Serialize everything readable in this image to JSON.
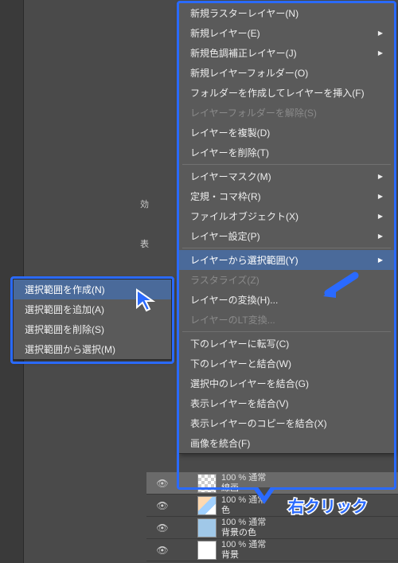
{
  "palette_labels": {
    "effect": "効",
    "display": "表"
  },
  "main_menu": {
    "items": [
      {
        "label": "新規ラスターレイヤー(N)",
        "enabled": true,
        "sub": false
      },
      {
        "label": "新規レイヤー(E)",
        "enabled": true,
        "sub": true
      },
      {
        "label": "新規色調補正レイヤー(J)",
        "enabled": true,
        "sub": true
      },
      {
        "label": "新規レイヤーフォルダー(O)",
        "enabled": true,
        "sub": false
      },
      {
        "label": "フォルダーを作成してレイヤーを挿入(F)",
        "enabled": true,
        "sub": false
      },
      {
        "label": "レイヤーフォルダーを解除(S)",
        "enabled": false,
        "sub": false
      },
      {
        "label": "レイヤーを複製(D)",
        "enabled": true,
        "sub": false
      },
      {
        "label": "レイヤーを削除(T)",
        "enabled": true,
        "sub": false
      },
      {
        "sep": true
      },
      {
        "label": "レイヤーマスク(M)",
        "enabled": true,
        "sub": true
      },
      {
        "label": "定規・コマ枠(R)",
        "enabled": true,
        "sub": true
      },
      {
        "label": "ファイルオブジェクト(X)",
        "enabled": true,
        "sub": true
      },
      {
        "label": "レイヤー設定(P)",
        "enabled": true,
        "sub": true
      },
      {
        "sep": true
      },
      {
        "label": "レイヤーから選択範囲(Y)",
        "enabled": true,
        "sub": true,
        "highlight": true
      },
      {
        "label": "ラスタライズ(Z)",
        "enabled": false,
        "sub": false
      },
      {
        "label": "レイヤーの変換(H)...",
        "enabled": true,
        "sub": false
      },
      {
        "label": "レイヤーのLT変換...",
        "enabled": false,
        "sub": false
      },
      {
        "sep": true
      },
      {
        "label": "下のレイヤーに転写(C)",
        "enabled": true,
        "sub": false
      },
      {
        "label": "下のレイヤーと結合(W)",
        "enabled": true,
        "sub": false
      },
      {
        "label": "選択中のレイヤーを結合(G)",
        "enabled": true,
        "sub": false
      },
      {
        "label": "表示レイヤーを結合(V)",
        "enabled": true,
        "sub": false
      },
      {
        "label": "表示レイヤーのコピーを結合(X)",
        "enabled": true,
        "sub": false
      },
      {
        "label": "画像を統合(F)",
        "enabled": true,
        "sub": false
      }
    ]
  },
  "sub_menu": {
    "items": [
      {
        "label": "選択範囲を作成(N)",
        "highlight": true
      },
      {
        "label": "選択範囲を追加(A)"
      },
      {
        "label": "選択範囲を削除(S)"
      },
      {
        "label": "選択範囲から選択(M)"
      }
    ]
  },
  "callout_text": "右クリック",
  "layers": [
    {
      "opacity": "100 % 通常",
      "name": "線画",
      "thumb": "checker",
      "selected": true
    },
    {
      "opacity": "100 % 通常",
      "name": "色",
      "thumb": "art"
    },
    {
      "opacity": "100 % 通常",
      "name": "背景の色",
      "thumb": "solid"
    },
    {
      "opacity": "100 % 通常",
      "name": "背景",
      "thumb": "white"
    }
  ]
}
